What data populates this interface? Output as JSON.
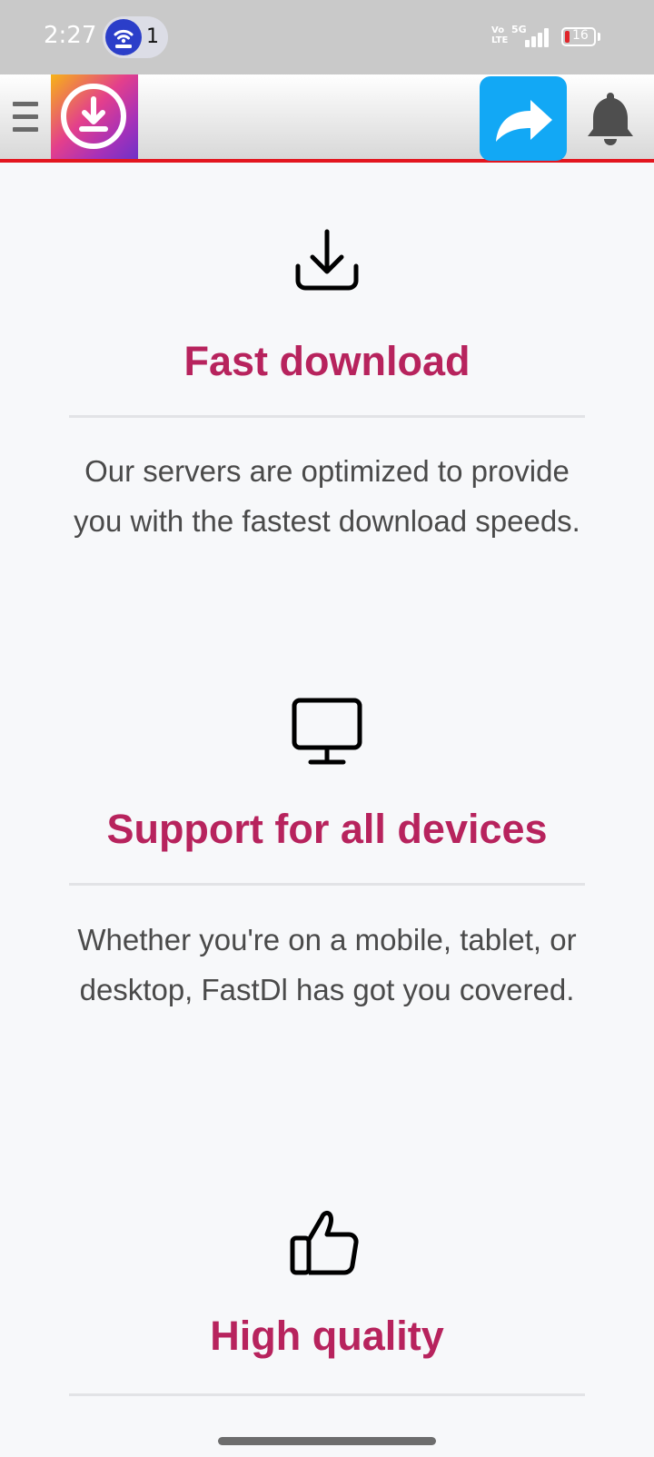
{
  "status_bar": {
    "time": "2:27",
    "hotspot_count": "1",
    "volte": "Vo\nLTE",
    "network": "5G",
    "battery": "16"
  },
  "app_bar": {
    "menu_icon": "hamburger-menu-icon",
    "logo_icon": "download-circle-icon",
    "share_icon": "share-arrow-icon",
    "bell_icon": "bell-icon",
    "accent_color": "#e3161f"
  },
  "features": [
    {
      "icon": "download-tray-icon",
      "title": "Fast download",
      "text": "Our servers are optimized to provide you with the fastest download speeds."
    },
    {
      "icon": "monitor-icon",
      "title": "Support for all devices",
      "text": "Whether you're on a mobile, tablet, or desktop, FastDl has got you covered."
    },
    {
      "icon": "thumbs-up-icon",
      "title": "High quality",
      "text": ""
    }
  ],
  "colors": {
    "title": "#b7235d",
    "text": "#4a4a4a",
    "share_button": "#12a8f5"
  }
}
